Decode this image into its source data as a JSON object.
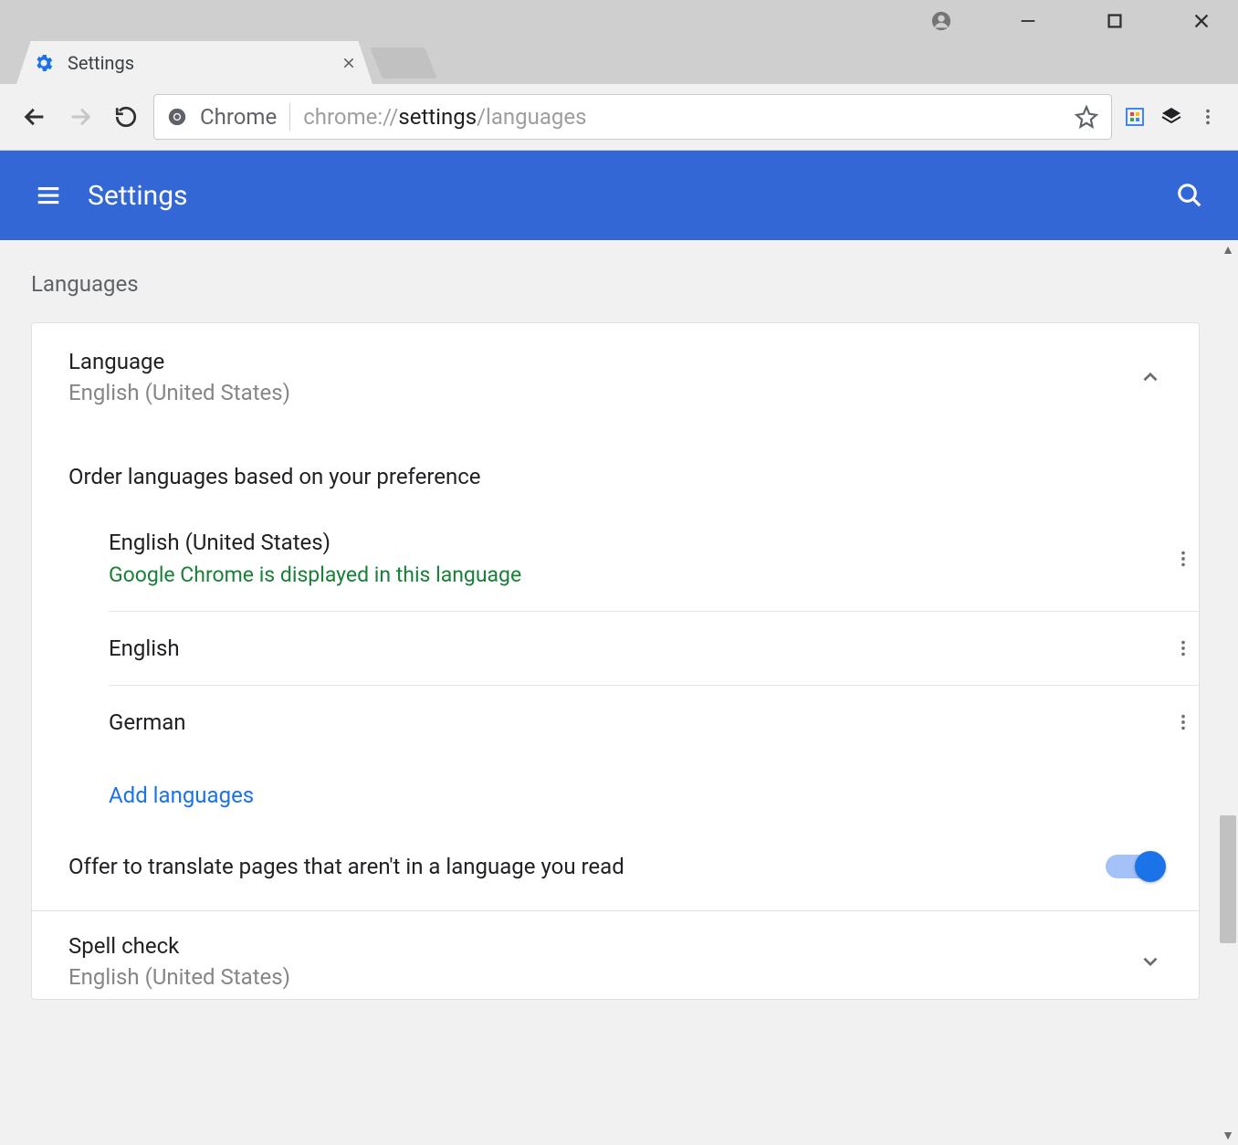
{
  "tab": {
    "title": "Settings"
  },
  "omnibox": {
    "origin_label": "Chrome",
    "url_prefix": "chrome://",
    "url_strong": "settings",
    "url_suffix": "/languages"
  },
  "header": {
    "title": "Settings"
  },
  "section": {
    "label": "Languages",
    "language_block": {
      "title": "Language",
      "subtitle": "English (United States)",
      "order_label": "Order languages based on your preference",
      "items": [
        {
          "name": "English (United States)",
          "note": "Google Chrome is displayed in this language"
        },
        {
          "name": "English",
          "note": ""
        },
        {
          "name": "German",
          "note": ""
        }
      ],
      "add_label": "Add languages"
    },
    "translate": {
      "label": "Offer to translate pages that aren't in a language you read",
      "on": true
    },
    "spellcheck": {
      "title": "Spell check",
      "subtitle": "English (United States)"
    }
  }
}
